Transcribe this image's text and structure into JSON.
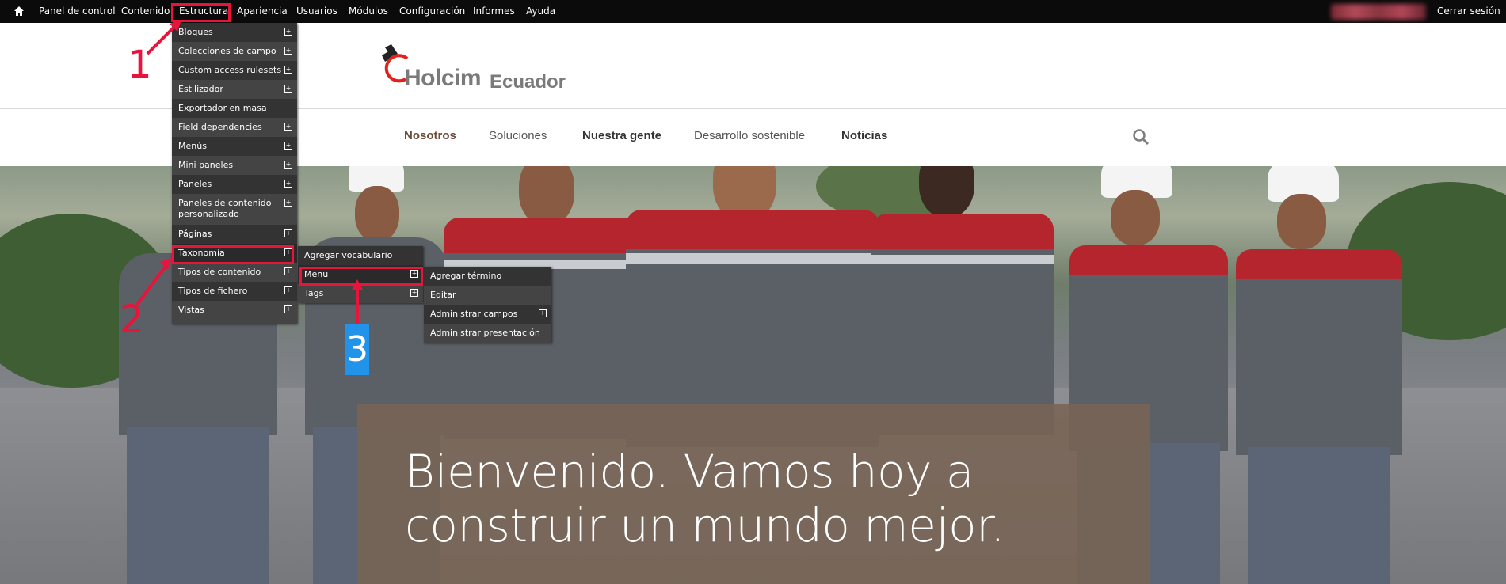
{
  "toolbar": {
    "items": [
      "Panel de control",
      "Contenido",
      "Estructura",
      "Apariencia",
      "Usuarios",
      "Módulos",
      "Configuración",
      "Informes",
      "Ayuda"
    ],
    "logout": "Cerrar sesión",
    "icons": {
      "home": "home-icon"
    }
  },
  "site": {
    "logo_word": "Holcim",
    "logo_country": "Ecuador",
    "nav": [
      "Nosotros",
      "Soluciones",
      "Nuestra gente",
      "Desarrollo sostenible",
      "Noticias"
    ]
  },
  "hero": {
    "line1": "Bienvenido. Vamos hoy a",
    "line2": "construir un mundo mejor."
  },
  "structure_menu": {
    "items": [
      "Bloques",
      "Colecciones de campo",
      "Custom access rulesets",
      "Estilizador",
      "Exportador en masa",
      "Field dependencies",
      "Menús",
      "Mini paneles",
      "Paneles",
      "Paneles de contenido personalizado",
      "Páginas",
      "Taxonomía",
      "Tipos de contenido",
      "Tipos de fichero",
      "Vistas"
    ]
  },
  "taxonomy_menu": {
    "items": [
      "Agregar vocabulario",
      "Menu",
      "Tags"
    ]
  },
  "menu_vocab_menu": {
    "items": [
      "Agregar término",
      "Editar",
      "Administrar campos",
      "Administrar presentación"
    ]
  },
  "annotations": {
    "n1": "1",
    "n2": "2",
    "n3": "3"
  },
  "colors": {
    "annotation_red": "#e8143c",
    "annotation_blue": "#2193e8",
    "toolbar_bg": "#0b0b0b",
    "menu_bg": "#333333",
    "hero_box": "#786454"
  }
}
